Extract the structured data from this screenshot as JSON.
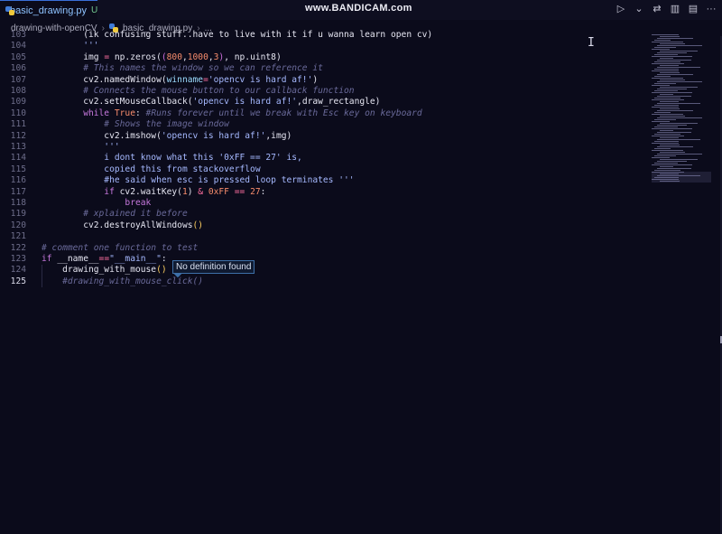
{
  "tab": {
    "filename": "basic_drawing.py",
    "status": "U",
    "close": "×"
  },
  "watermark": "www.BANDICAM.com",
  "toolbar": {
    "run": "▷",
    "dropdown": "⌄",
    "compare": "⇄",
    "split": "▥",
    "layout": "▤",
    "more": "···"
  },
  "breadcrumb": {
    "folder": "drawing-with-openCV",
    "sep": "›",
    "file": "basic_drawing.py",
    "sep2": "›",
    "tail": "..."
  },
  "hover_tooltip": "No definition found",
  "lines": [
    {
      "n": "103",
      "tokens": [
        [
          "t-var",
          "        (ik confusing stuff..have to live with it if u wanna learn open cv)"
        ]
      ]
    },
    {
      "n": "104",
      "tokens": [
        [
          "t-str",
          "        '''"
        ]
      ]
    },
    {
      "n": "105",
      "tokens": [
        [
          "t-var",
          "        img "
        ],
        [
          "t-op",
          "="
        ],
        [
          "t-var",
          " np.zeros("
        ],
        [
          "t-br2",
          "("
        ],
        [
          "t-num",
          "800"
        ],
        [
          "t-var",
          ","
        ],
        [
          "t-num",
          "1000"
        ],
        [
          "t-var",
          ","
        ],
        [
          "t-num",
          "3"
        ],
        [
          "t-br2",
          ")"
        ],
        [
          "t-var",
          ", np.uint8)"
        ]
      ]
    },
    {
      "n": "106",
      "tokens": [
        [
          "t-cm",
          "        # This names the window so we can reference it"
        ]
      ]
    },
    {
      "n": "107",
      "tokens": [
        [
          "t-var",
          "        cv2.namedWindow("
        ],
        [
          "t-attr",
          "winname"
        ],
        [
          "t-op",
          "="
        ],
        [
          "t-str",
          "'opencv is hard af!'"
        ],
        [
          "t-var",
          ")"
        ]
      ]
    },
    {
      "n": "108",
      "tokens": [
        [
          "t-cm",
          "        # Connects the mouse button to our callback function"
        ]
      ]
    },
    {
      "n": "109",
      "tokens": [
        [
          "t-var",
          "        cv2.setMouseCallback("
        ],
        [
          "t-str",
          "'opencv is hard af!'"
        ],
        [
          "t-var",
          ",draw_rectangle)"
        ]
      ]
    },
    {
      "n": "110",
      "tokens": [
        [
          "t-kw",
          "        while "
        ],
        [
          "t-num",
          "True"
        ],
        [
          "t-var",
          ": "
        ],
        [
          "t-cm",
          "#Runs forever until we break with Esc key on keyboard"
        ]
      ]
    },
    {
      "n": "111",
      "tokens": [
        [
          "t-cm",
          "            # Shows the image window"
        ]
      ]
    },
    {
      "n": "112",
      "tokens": [
        [
          "t-var",
          "            cv2.imshow("
        ],
        [
          "t-str",
          "'opencv is hard af!'"
        ],
        [
          "t-var",
          ",img)"
        ]
      ]
    },
    {
      "n": "113",
      "tokens": [
        [
          "t-str",
          "            '''"
        ]
      ]
    },
    {
      "n": "114",
      "tokens": [
        [
          "t-str",
          "            i dont know what this '0xFF == 27' is,"
        ]
      ]
    },
    {
      "n": "115",
      "tokens": [
        [
          "t-str",
          "            copied this from stackoverflow"
        ]
      ]
    },
    {
      "n": "116",
      "tokens": [
        [
          "t-str",
          "            #he said when esc is pressed loop terminates '''"
        ]
      ]
    },
    {
      "n": "117",
      "tokens": [
        [
          "t-kw",
          "            if "
        ],
        [
          "t-var",
          "cv2.waitKey("
        ],
        [
          "t-num",
          "1"
        ],
        [
          "t-var",
          ") "
        ],
        [
          "t-op",
          "&"
        ],
        [
          "t-var",
          " "
        ],
        [
          "t-num",
          "0xFF"
        ],
        [
          "t-var",
          " "
        ],
        [
          "t-op",
          "=="
        ],
        [
          "t-var",
          " "
        ],
        [
          "t-num",
          "27"
        ],
        [
          "t-var",
          ":"
        ]
      ]
    },
    {
      "n": "118",
      "tokens": [
        [
          "t-kw",
          "                break"
        ]
      ]
    },
    {
      "n": "119",
      "tokens": [
        [
          "t-cm",
          "        # xplained it before"
        ]
      ]
    },
    {
      "n": "120",
      "tokens": [
        [
          "t-var",
          "        cv2.destroyAllWindows"
        ],
        [
          "t-br",
          "()"
        ]
      ]
    },
    {
      "n": "121",
      "tokens": []
    },
    {
      "n": "122",
      "tokens": [
        [
          "t-cm",
          "# comment one function to test"
        ]
      ]
    },
    {
      "n": "123",
      "tokens": [
        [
          "t-kw",
          "if "
        ],
        [
          "t-var",
          "__name__"
        ],
        [
          "t-op",
          "=="
        ],
        [
          "t-str",
          "\"__main__\""
        ],
        [
          "t-var",
          ":"
        ]
      ]
    },
    {
      "n": "124",
      "tokens": [
        [
          "t-var",
          "    drawing_with_mouse"
        ],
        [
          "t-br",
          "()"
        ]
      ]
    },
    {
      "n": "125",
      "tokens": [
        [
          "t-cm",
          "    #drawing_with_mouse_click()"
        ]
      ],
      "active": true
    }
  ]
}
